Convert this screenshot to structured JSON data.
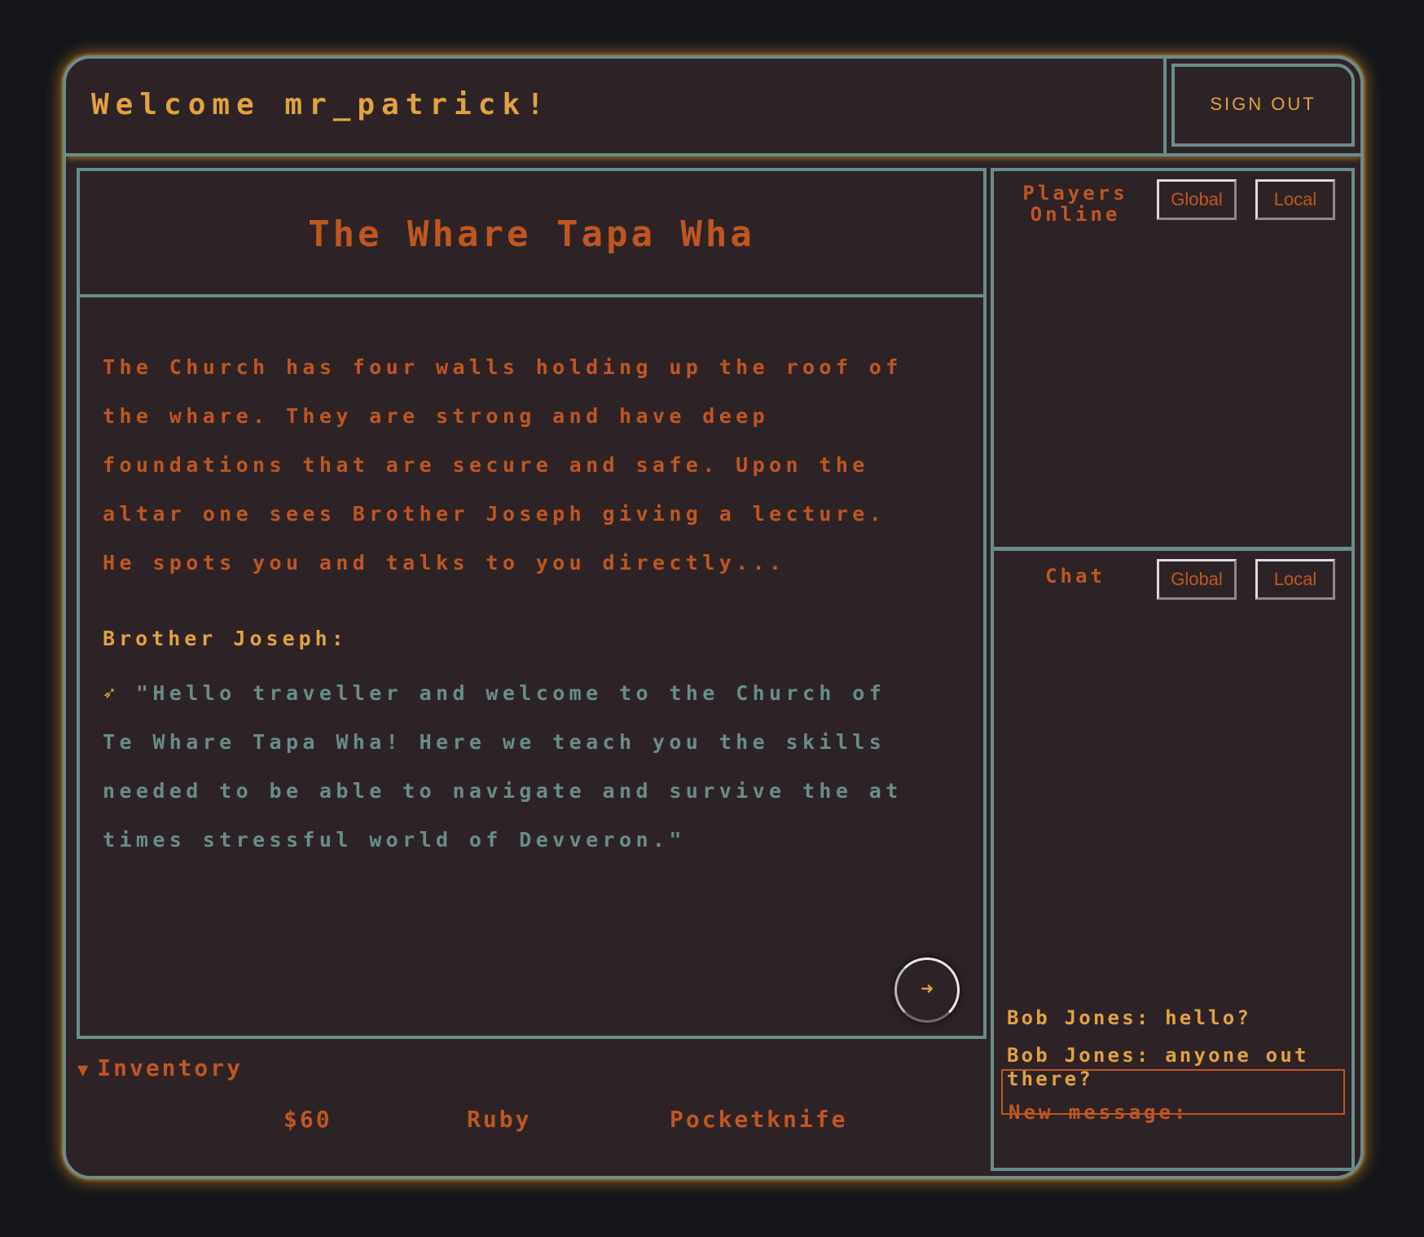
{
  "header": {
    "welcome": "Welcome mr_patrick!",
    "signout_label": "SIGN OUT"
  },
  "location": {
    "title": "The Whare Tapa Wha",
    "narration": "The Church has four walls holding up the roof of the whare. They are strong and have deep foundations that are secure and safe. Upon the altar one sees Brother Joseph giving a lecture. He spots you and talks to you directly...",
    "speaker": "Brother Joseph:",
    "quote_marker": "➶",
    "quote": "\"Hello traveller and welcome to the Church of Te Whare Tapa Wha! Here we teach you the skills needed to be able to navigate and survive the at times stressful world of Devveron.\"",
    "next_icon": "➜"
  },
  "inventory": {
    "label": "Inventory",
    "toggle_icon": "▼",
    "items": [
      "$60",
      "Ruby",
      "Pocketknife"
    ]
  },
  "players_panel": {
    "title_line1": "Players",
    "title_line2": "Online",
    "global_label": "Global",
    "local_label": "Local"
  },
  "chat_panel": {
    "title": "Chat",
    "global_label": "Global",
    "local_label": "Local",
    "messages": [
      {
        "text": "Bob Jones: hello?"
      },
      {
        "text": "Bob Jones: anyone out there?"
      }
    ],
    "new_message_label": "New message:",
    "new_message_value": ""
  },
  "colors": {
    "background": "#14161a",
    "panel": "#2d2327",
    "border": "#6a8c8a",
    "accent_gold": "#e2a23e",
    "accent_rust": "#c0561f"
  }
}
